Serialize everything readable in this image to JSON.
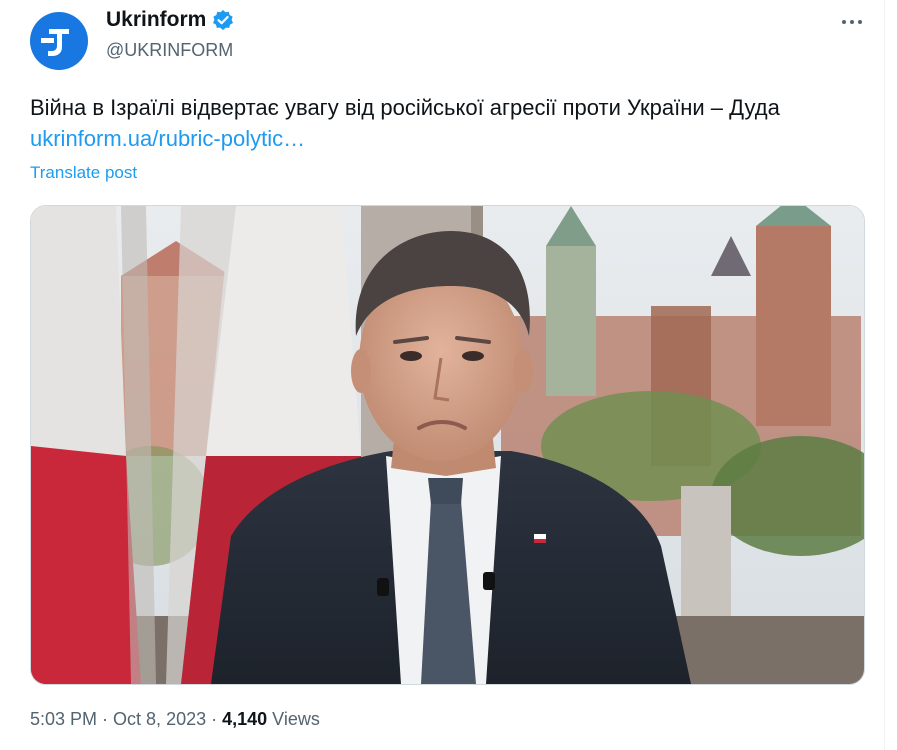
{
  "account": {
    "display_name": "Ukrinform",
    "handle": "@UKRINFORM",
    "avatar_icon": "ukrinform-logo",
    "verified_icon": "verified-badge-icon",
    "brand_color": "#1877e0"
  },
  "post": {
    "text": "Війна в Ізраїлі відвертає увагу від російської агресії проти України – Дуда",
    "link": "ukrinform.ua/rubric-polytic…",
    "translate_label": "Translate post",
    "media_description_icon": "video-thumbnail"
  },
  "meta": {
    "time": "5:03 PM",
    "separator": " · ",
    "date": "Oct 8, 2023",
    "views_count": "4,140",
    "views_label": " Views"
  },
  "colors": {
    "link": "#1d9bf0",
    "secondary_text": "#536471",
    "primary_text": "#0f1419"
  }
}
